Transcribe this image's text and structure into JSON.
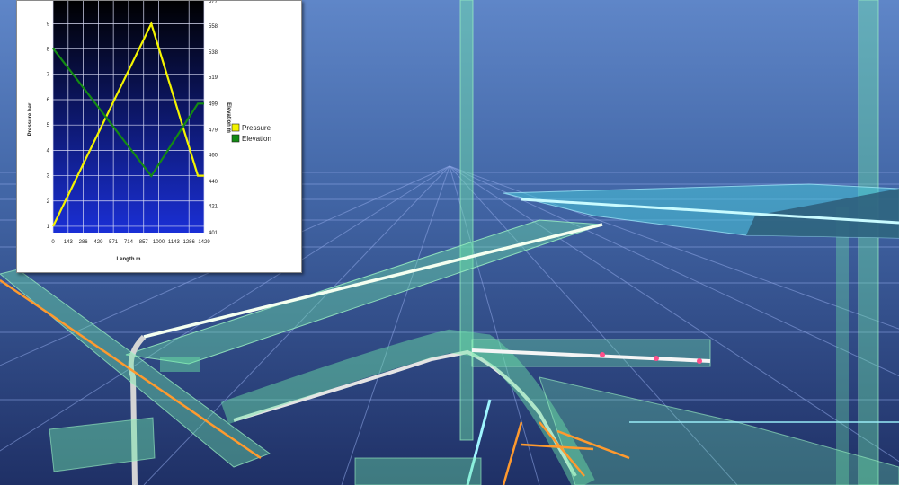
{
  "chart_data": {
    "type": "line",
    "x": [
      0,
      857,
      1286,
      1429
    ],
    "xlabel": "Length  m",
    "ylabel": "Pressure  bar",
    "y2label": "Elevation  m",
    "x_ticks": [
      "0",
      "143",
      "286",
      "429",
      "571",
      "714",
      "857",
      "1000",
      "1143",
      "1286",
      "1429"
    ],
    "y_ticks": [
      "1",
      "2",
      "3",
      "4",
      "5",
      "6",
      "7",
      "8",
      "9"
    ],
    "y2_ticks": [
      "401",
      "421",
      "440",
      "460",
      "479",
      "499",
      "519",
      "538",
      "558",
      "577"
    ],
    "xlim": [
      0,
      1429
    ],
    "ylim": [
      0.75,
      9.9
    ],
    "y2lim": [
      401,
      577
    ],
    "grid": true,
    "legend_position": "right",
    "series": [
      {
        "name": "Pressure",
        "color": "#f4f400",
        "axis": "left",
        "x": [
          0,
          930,
          1370,
          1429
        ],
        "values": [
          1.0,
          9.0,
          3.0,
          3.0
        ]
      },
      {
        "name": "Elevation",
        "color": "#138a13",
        "axis": "right",
        "x": [
          0,
          930,
          1370,
          1429
        ],
        "values": [
          541,
          444,
          499,
          499
        ]
      }
    ]
  }
}
